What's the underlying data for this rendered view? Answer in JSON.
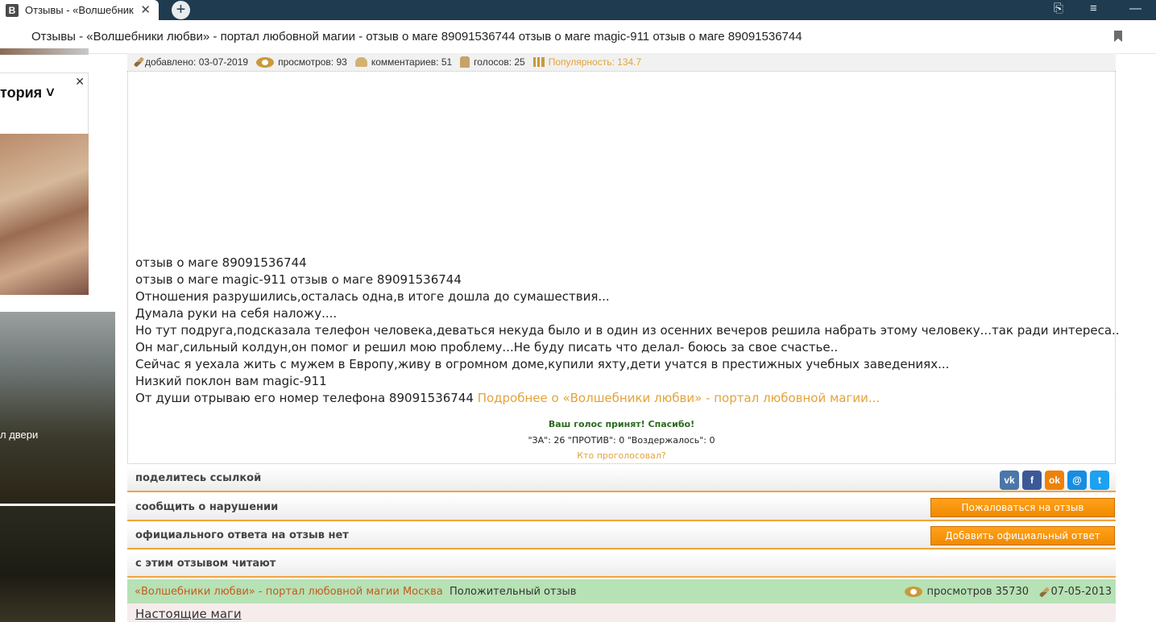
{
  "browser": {
    "tab_title": "Отзывы - «Волшебники любви» - портал любовной магии",
    "tab_close": "✕",
    "tab_icon": "B",
    "new_tab": "+",
    "page_title": "Отзывы - «Волшебники любви» - портал любовной магии - отзыв о маге 89091536744 отзыв о маге magic-911 отзыв о маге 89091536744"
  },
  "sidebar": {
    "ad_title": "тория ˅",
    "ad_close": "✕",
    "city_caption": "л двери"
  },
  "meta": {
    "added": "добавлено: 03-07-2019",
    "views": "просмотров: 93",
    "comments": "комментариев: 51",
    "votes": "голосов: 25",
    "popularity": "Популярность: 134.7"
  },
  "review": {
    "lines": [
      "отзыв о маге 89091536744",
      "отзыв о маге magic-911 отзыв о маге 89091536744",
      "Отношения разрушились,осталась одна,в итоге дошла до сумашествия...",
      "Думала руки на себя наложу....",
      "Но тут подруга,подсказала телефон человека,деваться некуда было и в один из осенних вечеров решила набрать этому человеку...так ради интереса..",
      "Он маг,сильный колдун,он помог и решил мою проблему...Не буду писать что делал- боюсь за свое счастье..",
      "Сейчас я уехала жить с мужем в Европу,живу в огромном доме,купили яхту,дети учатся в престижных учебных заведениях...",
      "Низкий поклон вам magic-911"
    ],
    "last_line": "От души отрываю его номер телефона 89091536744",
    "more_link": "Подробнее о «Волшебники любви» - портал любовной магии..."
  },
  "vote": {
    "accepted": "Ваш голос принят! Спасибо!",
    "counts": "\"ЗА\": 26 \"ПРОТИВ\": 0 \"Воздержалось\": 0",
    "who_voted": "Кто проголосовал?"
  },
  "sections": {
    "share": "поделитесь ссылкой",
    "report": "сообщить о нарушении",
    "report_button": "Пожаловаться на отзыв",
    "official": "официального ответа на отзыв нет",
    "official_button": "Добавить официальный ответ",
    "related": "с этим отзывом читают"
  },
  "social": {
    "vk": "vk",
    "fb": "f",
    "ok": "ok",
    "mm": "@",
    "tw": "t"
  },
  "related_item": {
    "link": "«Волшебники любви» - портал любовной магии Москва",
    "type": "Положительный отзыв",
    "views": "просмотров 35730",
    "date": "07-05-2013"
  },
  "bottom": {
    "link": "Настоящие маги"
  },
  "colors": {
    "titlebar": "#1e3b4f",
    "accent_orange": "#f08a00",
    "link_orange": "#e3a33a",
    "related_green": "#b7e2b5",
    "vote_green": "#2b6a1f"
  }
}
